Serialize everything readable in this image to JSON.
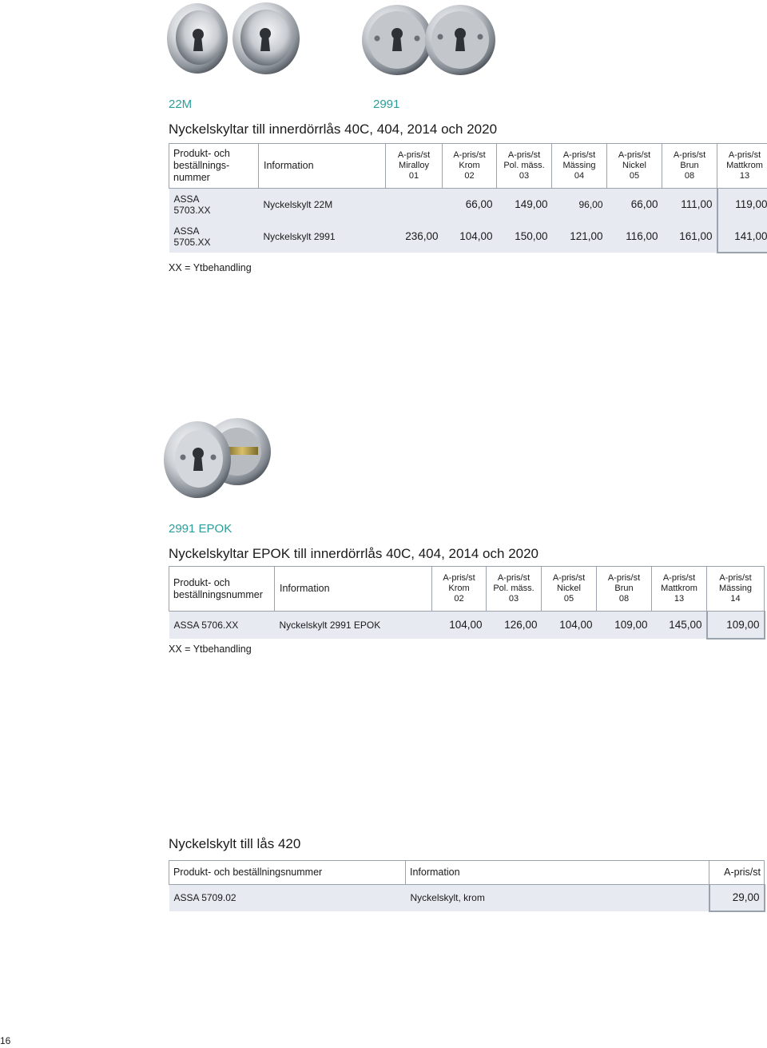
{
  "section1": {
    "codes": [
      "22M",
      "2991"
    ],
    "title": "Nyckelskyltar till innerdörrlås 40C, 404, 2014 och 2020",
    "headers": {
      "product": "Produkt- och beställnings-nummer",
      "info": "Information",
      "prices": [
        {
          "l1": "A-pris/st",
          "l2": "Miralloy",
          "l3": "01"
        },
        {
          "l1": "A-pris/st",
          "l2": "Krom",
          "l3": "02"
        },
        {
          "l1": "A-pris/st",
          "l2": "Pol. mäss.",
          "l3": "03"
        },
        {
          "l1": "A-pris/st",
          "l2": "Mässing",
          "l3": "04"
        },
        {
          "l1": "A-pris/st",
          "l2": "Nickel",
          "l3": "05"
        },
        {
          "l1": "A-pris/st",
          "l2": "Brun",
          "l3": "08"
        },
        {
          "l1": "A-pris/st",
          "l2": "Mattkrom",
          "l3": "13"
        }
      ]
    },
    "rows": [
      {
        "code1": "ASSA",
        "code2": "5703.XX",
        "info": "Nyckelskylt 22M",
        "prices": [
          "",
          "66,00",
          "149,00",
          "96,00",
          "66,00",
          "111,00",
          "119,00"
        ]
      },
      {
        "code1": "ASSA",
        "code2": "5705.XX",
        "info": "Nyckelskylt 2991",
        "prices": [
          "236,00",
          "104,00",
          "150,00",
          "121,00",
          "116,00",
          "161,00",
          "141,00"
        ]
      }
    ],
    "note": "XX = Ytbehandling"
  },
  "section2": {
    "code": "2991 EPOK",
    "title": "Nyckelskyltar EPOK till innerdörrlås 40C, 404, 2014 och 2020",
    "headers": {
      "product": "Produkt- och beställningsnummer",
      "info": "Information",
      "prices": [
        {
          "l1": "A-pris/st",
          "l2": "Krom",
          "l3": "02"
        },
        {
          "l1": "A-pris/st",
          "l2": "Pol. mäss.",
          "l3": "03"
        },
        {
          "l1": "A-pris/st",
          "l2": "Nickel",
          "l3": "05"
        },
        {
          "l1": "A-pris/st",
          "l2": "Brun",
          "l3": "08"
        },
        {
          "l1": "A-pris/st",
          "l2": "Mattkrom",
          "l3": "13"
        },
        {
          "l1": "A-pris/st",
          "l2": "Mässing",
          "l3": "14"
        }
      ]
    },
    "rows": [
      {
        "code": "ASSA 5706.XX",
        "info": "Nyckelskylt 2991 EPOK",
        "prices": [
          "104,00",
          "126,00",
          "104,00",
          "109,00",
          "145,00",
          "109,00"
        ]
      }
    ],
    "note": "XX = Ytbehandling"
  },
  "section3": {
    "title": "Nyckelskylt till lås 420",
    "headers": {
      "product": "Produkt- och beställningsnummer",
      "info": "Information",
      "price": "A-pris/st"
    },
    "rows": [
      {
        "code": "ASSA 5709.02",
        "info": "Nyckelskylt, krom",
        "price": "29,00"
      }
    ]
  },
  "page_number": "16",
  "colors": {
    "accent": "#2a9d9a",
    "row_bg": "#e7eaf1",
    "border": "#9aa3ad"
  }
}
